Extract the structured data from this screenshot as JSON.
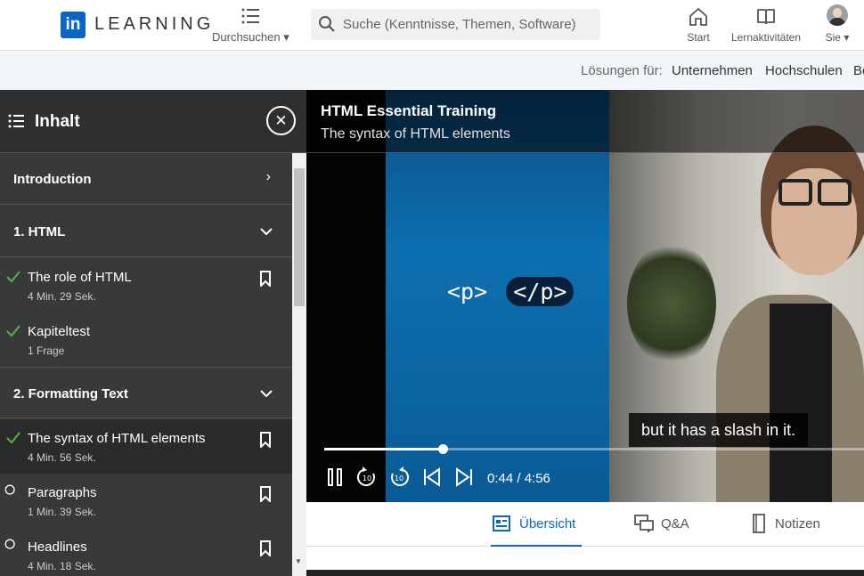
{
  "header": {
    "logo_mark": "in",
    "logo_text": "LEARNING",
    "browse_label": "Durchsuchen",
    "search_placeholder": "Suche (Kenntnisse, Themen, Software)",
    "nav": [
      {
        "label": "Start",
        "icon": "home-icon"
      },
      {
        "label": "Lernaktivitäten",
        "icon": "book-icon"
      },
      {
        "label": "Sie",
        "icon": "avatar"
      }
    ]
  },
  "subbar": {
    "prefix": "Lösungen für:",
    "links": [
      "Unternehmen",
      "Hochschulen",
      "Be"
    ]
  },
  "sidebar": {
    "title": "Inhalt",
    "sections": [
      {
        "title": "Introduction",
        "expanded": false
      },
      {
        "title": "1. HTML",
        "expanded": true
      },
      {
        "title": "2. Formatting Text",
        "expanded": true
      }
    ],
    "items": [
      {
        "title": "The role of HTML",
        "meta": "4 Min. 29 Sek.",
        "done": true
      },
      {
        "title": "Kapiteltest",
        "meta": "1 Frage",
        "done": true
      },
      {
        "title": "The syntax of HTML elements",
        "meta": "4 Min. 56 Sek.",
        "done": true,
        "active": true
      },
      {
        "title": "Paragraphs",
        "meta": "1 Min. 39 Sek.",
        "done": false
      },
      {
        "title": "Headlines",
        "meta": "4 Min. 18 Sek.",
        "done": false
      }
    ]
  },
  "player": {
    "course_title": "HTML Essential Training",
    "video_title": "The syntax of HTML elements",
    "slide_open_tag": "<p>",
    "slide_close_tag": "</p>",
    "caption": "but it has a slash in it.",
    "time_current": "0:44",
    "time_total": "4:56",
    "timecode": "0:44 / 4:56",
    "progress_fraction": 0.22
  },
  "tabs": [
    {
      "label": "Übersicht",
      "active": true
    },
    {
      "label": "Q&A",
      "active": false
    },
    {
      "label": "Notizen",
      "active": false
    }
  ],
  "colors": {
    "brand": "#0a66c2",
    "sidebar_bg": "#38393a",
    "check": "#57b33e"
  }
}
